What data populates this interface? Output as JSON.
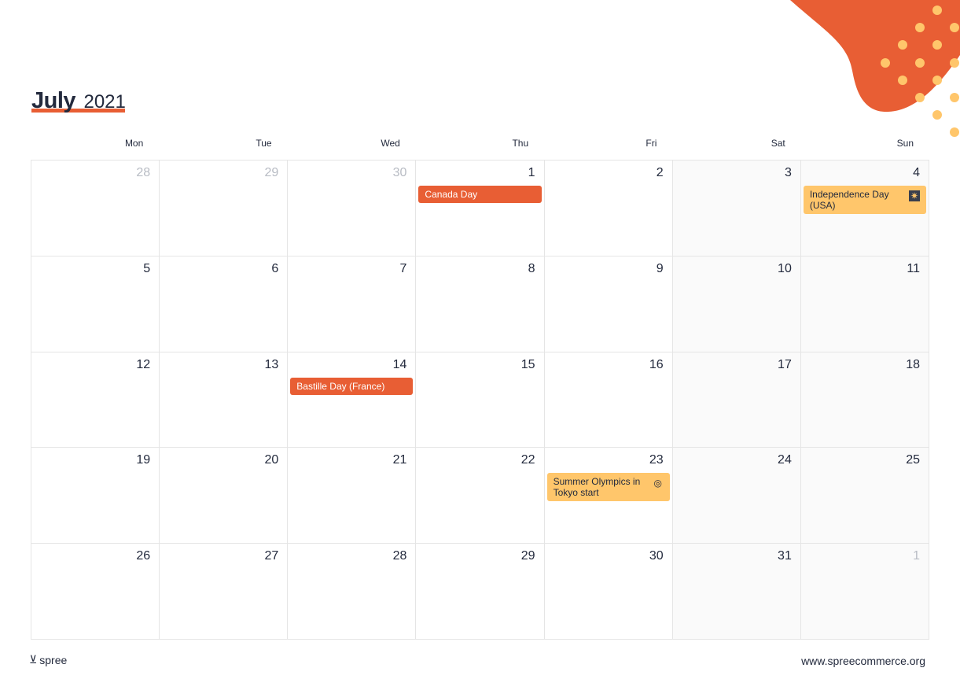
{
  "header": {
    "month": "July",
    "year": "2021"
  },
  "colors": {
    "accent": "#e85e34",
    "highlight": "#ffc66b",
    "text": "#232a3d",
    "muted": "#b8bcc4"
  },
  "weekdays": [
    "Mon",
    "Tue",
    "Wed",
    "Thu",
    "Fri",
    "Sat",
    "Sun"
  ],
  "weeks": [
    [
      {
        "day": "28",
        "other": true
      },
      {
        "day": "29",
        "other": true
      },
      {
        "day": "30",
        "other": true
      },
      {
        "day": "1",
        "event": {
          "label": "Canada Day",
          "style": "orange"
        }
      },
      {
        "day": "2"
      },
      {
        "day": "3"
      },
      {
        "day": "4",
        "event": {
          "label": "Independence Day (USA)",
          "style": "yellow",
          "icon": "fireworks-icon"
        }
      }
    ],
    [
      {
        "day": "5"
      },
      {
        "day": "6"
      },
      {
        "day": "7"
      },
      {
        "day": "8"
      },
      {
        "day": "9"
      },
      {
        "day": "10"
      },
      {
        "day": "11"
      }
    ],
    [
      {
        "day": "12"
      },
      {
        "day": "13"
      },
      {
        "day": "14",
        "event": {
          "label": "Bastille Day (France)",
          "style": "orange"
        }
      },
      {
        "day": "15"
      },
      {
        "day": "16"
      },
      {
        "day": "17"
      },
      {
        "day": "18"
      }
    ],
    [
      {
        "day": "19"
      },
      {
        "day": "20"
      },
      {
        "day": "21"
      },
      {
        "day": "22"
      },
      {
        "day": "23",
        "event": {
          "label": "Summer Olympics in Tokyo start",
          "style": "yellow",
          "icon": "medal-icon"
        }
      },
      {
        "day": "24"
      },
      {
        "day": "25"
      }
    ],
    [
      {
        "day": "26"
      },
      {
        "day": "27"
      },
      {
        "day": "28"
      },
      {
        "day": "29"
      },
      {
        "day": "30"
      },
      {
        "day": "31"
      },
      {
        "day": "1",
        "other": true
      }
    ]
  ],
  "footer": {
    "brand": "spree",
    "url": "www.spreecommerce.org"
  }
}
